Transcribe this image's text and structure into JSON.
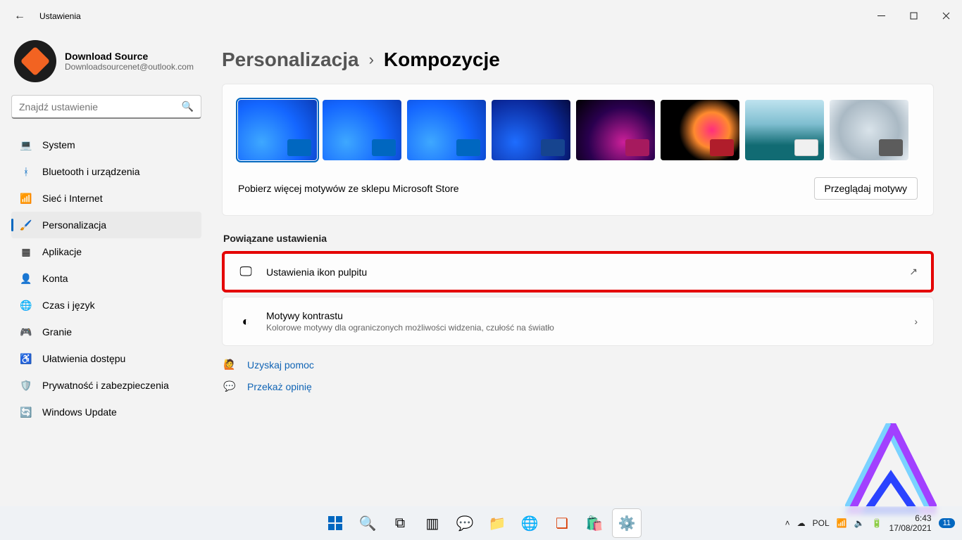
{
  "window": {
    "title": "Ustawienia"
  },
  "profile": {
    "name": "Download Source",
    "email": "Downloadsourcenet@outlook.com"
  },
  "search": {
    "placeholder": "Znajdź ustawienie"
  },
  "sidebar": {
    "items": [
      {
        "label": "System",
        "icon": "💻"
      },
      {
        "label": "Bluetooth i urządzenia",
        "icon": "ᚼ"
      },
      {
        "label": "Sieć i Internet",
        "icon": "📶"
      },
      {
        "label": "Personalizacja",
        "icon": "🖌️"
      },
      {
        "label": "Aplikacje",
        "icon": "▦"
      },
      {
        "label": "Konta",
        "icon": "👤"
      },
      {
        "label": "Czas i język",
        "icon": "🌐"
      },
      {
        "label": "Granie",
        "icon": "🎮"
      },
      {
        "label": "Ułatwienia dostępu",
        "icon": "♿"
      },
      {
        "label": "Prywatność i zabezpieczenia",
        "icon": "🛡️"
      },
      {
        "label": "Windows Update",
        "icon": "🔄"
      }
    ],
    "selected_index": 3
  },
  "breadcrumb": {
    "parent": "Personalizacja",
    "current": "Kompozycje"
  },
  "themes": {
    "store_label": "Pobierz więcej motywów ze sklepu Microsoft Store",
    "browse_button": "Przeglądaj motywy"
  },
  "related": {
    "heading": "Powiązane ustawienia",
    "items": [
      {
        "title": "Ustawienia ikon pulpitu",
        "subtitle": ""
      },
      {
        "title": "Motywy kontrastu",
        "subtitle": "Kolorowe motywy dla ograniczonych możliwości widzenia, czułość na światło"
      }
    ]
  },
  "help": {
    "get_help": "Uzyskaj pomoc",
    "feedback": "Przekaż opinię"
  },
  "taskbar": {
    "lang": "POL",
    "time": "6:43",
    "date": "17/08/2021",
    "badge": "11"
  }
}
